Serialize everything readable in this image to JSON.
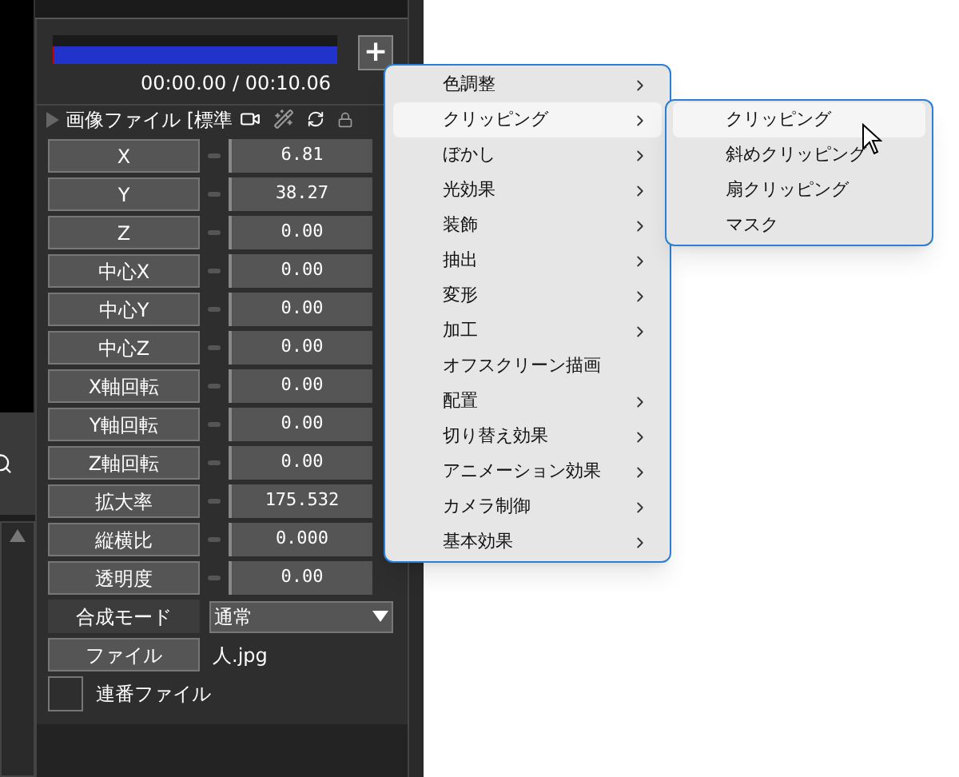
{
  "timeline": {
    "time": "00:00.00 / 00:10.06",
    "add_button": "+"
  },
  "object": {
    "title": "画像ファイル [標準"
  },
  "params": [
    {
      "label": "X",
      "value": "6.81"
    },
    {
      "label": "Y",
      "value": "38.27"
    },
    {
      "label": "Z",
      "value": "0.00"
    },
    {
      "label": "中心X",
      "value": "0.00"
    },
    {
      "label": "中心Y",
      "value": "0.00"
    },
    {
      "label": "中心Z",
      "value": "0.00"
    },
    {
      "label": "X軸回転",
      "value": "0.00"
    },
    {
      "label": "Y軸回転",
      "value": "0.00"
    },
    {
      "label": "Z軸回転",
      "value": "0.00"
    },
    {
      "label": "拡大率",
      "value": "175.532"
    },
    {
      "label": "縦横比",
      "value": "0.000"
    },
    {
      "label": "透明度",
      "value": "0.00"
    }
  ],
  "blend": {
    "label": "合成モード",
    "value": "通常"
  },
  "file": {
    "label": "ファイル",
    "value": "人.jpg"
  },
  "sequence": {
    "label": "連番ファイル",
    "checked": false
  },
  "menu": [
    {
      "label": "色調整",
      "submenu": true,
      "selected": false
    },
    {
      "label": "クリッピング",
      "submenu": true,
      "selected": true
    },
    {
      "label": "ぼかし",
      "submenu": true,
      "selected": false
    },
    {
      "label": "光効果",
      "submenu": true,
      "selected": false
    },
    {
      "label": "装飾",
      "submenu": true,
      "selected": false
    },
    {
      "label": "抽出",
      "submenu": true,
      "selected": false
    },
    {
      "label": "変形",
      "submenu": true,
      "selected": false
    },
    {
      "label": "加工",
      "submenu": true,
      "selected": false
    },
    {
      "label": "オフスクリーン描画",
      "submenu": false,
      "selected": false
    },
    {
      "label": "配置",
      "submenu": true,
      "selected": false
    },
    {
      "label": "切り替え効果",
      "submenu": true,
      "selected": false
    },
    {
      "label": "アニメーション効果",
      "submenu": true,
      "selected": false
    },
    {
      "label": "カメラ制御",
      "submenu": true,
      "selected": false
    },
    {
      "label": "基本効果",
      "submenu": true,
      "selected": false
    }
  ],
  "submenu": [
    {
      "label": "クリッピング",
      "selected": true
    },
    {
      "label": "斜めクリッピング",
      "selected": false
    },
    {
      "label": "扇クリッピング",
      "selected": false
    },
    {
      "label": "マスク",
      "selected": false
    }
  ]
}
